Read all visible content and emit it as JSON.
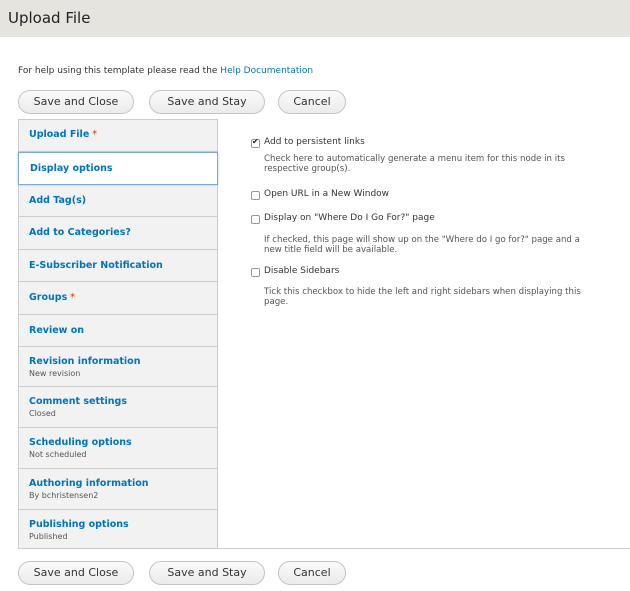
{
  "page": {
    "title": "Upload File"
  },
  "help": {
    "text": "For help using this template please read the ",
    "link": "Help Documentation"
  },
  "actions": {
    "save_close": "Save and Close",
    "save_stay": "Save and Stay",
    "cancel": "Cancel"
  },
  "tabs": [
    {
      "label": "Upload File",
      "required_mark": "*",
      "summary": "",
      "active": false
    },
    {
      "label": "Display options",
      "required_mark": "",
      "summary": "",
      "active": true
    },
    {
      "label": "Add Tag(s)",
      "required_mark": "",
      "summary": "",
      "active": false
    },
    {
      "label": "Add to Categories?",
      "required_mark": "",
      "summary": "",
      "active": false
    },
    {
      "label": "E-Subscriber Notification",
      "required_mark": "",
      "summary": "",
      "active": false
    },
    {
      "label": "Groups",
      "required_mark": "*",
      "summary": "",
      "active": false
    },
    {
      "label": "Review on",
      "required_mark": "",
      "summary": "",
      "active": false
    },
    {
      "label": "Revision information",
      "required_mark": "",
      "summary": "New revision",
      "active": false
    },
    {
      "label": "Comment settings",
      "required_mark": "",
      "summary": "Closed",
      "active": false
    },
    {
      "label": "Scheduling options",
      "required_mark": "",
      "summary": "Not scheduled",
      "active": false
    },
    {
      "label": "Authoring information",
      "required_mark": "",
      "summary": "By bchristensen2",
      "active": false
    },
    {
      "label": "Publishing options",
      "required_mark": "",
      "summary": "Published",
      "active": false
    }
  ],
  "display_options": {
    "persistent_links": {
      "label": "Add to persistent links",
      "checked": true,
      "description_line1": "Check here to automatically generate a menu item for this node in its",
      "description_line2": "respective group(s)."
    },
    "new_window": {
      "label": "Open URL in a New Window",
      "checked": false
    },
    "where_do_i_go": {
      "label": "Display on \"Where Do I Go For?\" page",
      "checked": false,
      "description_line1": "If checked, this page will show up on the \"Where do I go for?\" page and a",
      "description_line2": "new title field will be available."
    },
    "disable_sidebars": {
      "label": "Disable Sidebars",
      "checked": false,
      "description_line1": "Tick this checkbox to hide the left and right sidebars when displaying this",
      "description_line2": "page."
    }
  }
}
